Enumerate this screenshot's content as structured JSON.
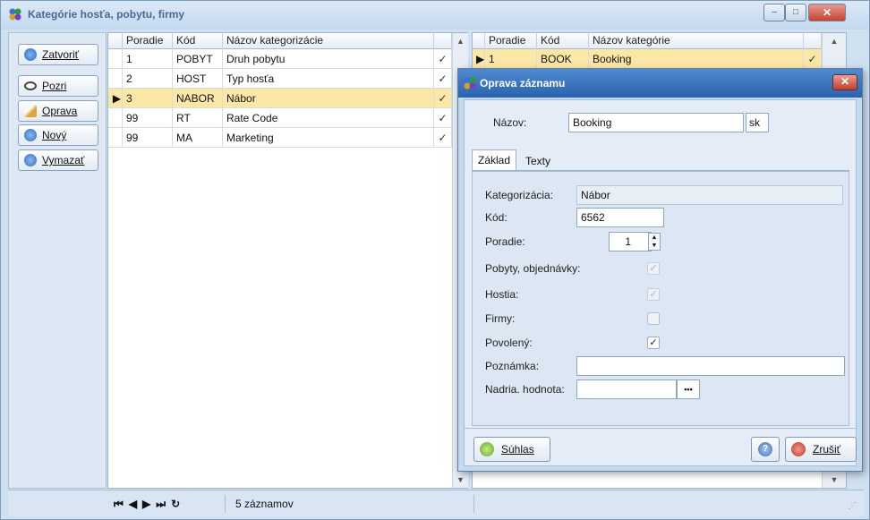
{
  "window": {
    "title": "Kategórie hosťa, pobytu, firmy",
    "controls": {
      "minimize": "–",
      "maximize": "□",
      "close": "✕"
    }
  },
  "toolbar": {
    "close": "Zatvoriť",
    "view": "Pozri",
    "edit": "Oprava",
    "new": "Nový",
    "delete": "Vymazať"
  },
  "left_grid": {
    "columns": [
      "Poradie",
      "Kód",
      "Názov kategorizácie"
    ],
    "rows": [
      {
        "order": "1",
        "code": "POBYT",
        "name": "Druh pobytu",
        "check": "✓"
      },
      {
        "order": "2",
        "code": "HOST",
        "name": "Typ hosťa",
        "check": "✓"
      },
      {
        "order": "3",
        "code": "NABOR",
        "name": "Nábor",
        "check": "✓"
      },
      {
        "order": "99",
        "code": "RT",
        "name": "Rate Code",
        "check": "✓"
      },
      {
        "order": "99",
        "code": "MA",
        "name": "Marketing",
        "check": "✓"
      }
    ],
    "selected_index": 2
  },
  "right_grid": {
    "columns": [
      "Poradie",
      "Kód",
      "Názov kategórie"
    ],
    "rows": [
      {
        "order": "1",
        "code": "BOOK",
        "name": "Booking",
        "check": "✓"
      }
    ]
  },
  "status": {
    "record_count": "5 záznamov",
    "nav": {
      "first": "⏮",
      "prev": "◀",
      "next": "▶",
      "last": "⏭",
      "refresh": "↻"
    }
  },
  "dialog": {
    "title": "Oprava záznamu",
    "close": "✕",
    "name_label": "Názov:",
    "name_value": "Booking",
    "lang": "sk",
    "tabs": [
      "Základ",
      "Texty"
    ],
    "fields": {
      "category_label": "Kategorizácia:",
      "category_value": "Nábor",
      "code_label": "Kód:",
      "code_value": "6562",
      "order_label": "Poradie:",
      "order_value": "1",
      "stays_label": "Pobyty, objednávky:",
      "guests_label": "Hostia:",
      "firms_label": "Firmy:",
      "enabled_label": "Povolený:",
      "note_label": "Poznámka:",
      "note_value": "",
      "parent_label": "Nadria. hodnota:",
      "parent_value": "",
      "ellipsis": "•••"
    },
    "buttons": {
      "ok": "Súhlas",
      "help": "?",
      "cancel": "Zrušiť"
    },
    "check_mark": "✓"
  },
  "colors": {
    "selection": "#fbe7a6",
    "title_active": "#2a63ad"
  }
}
